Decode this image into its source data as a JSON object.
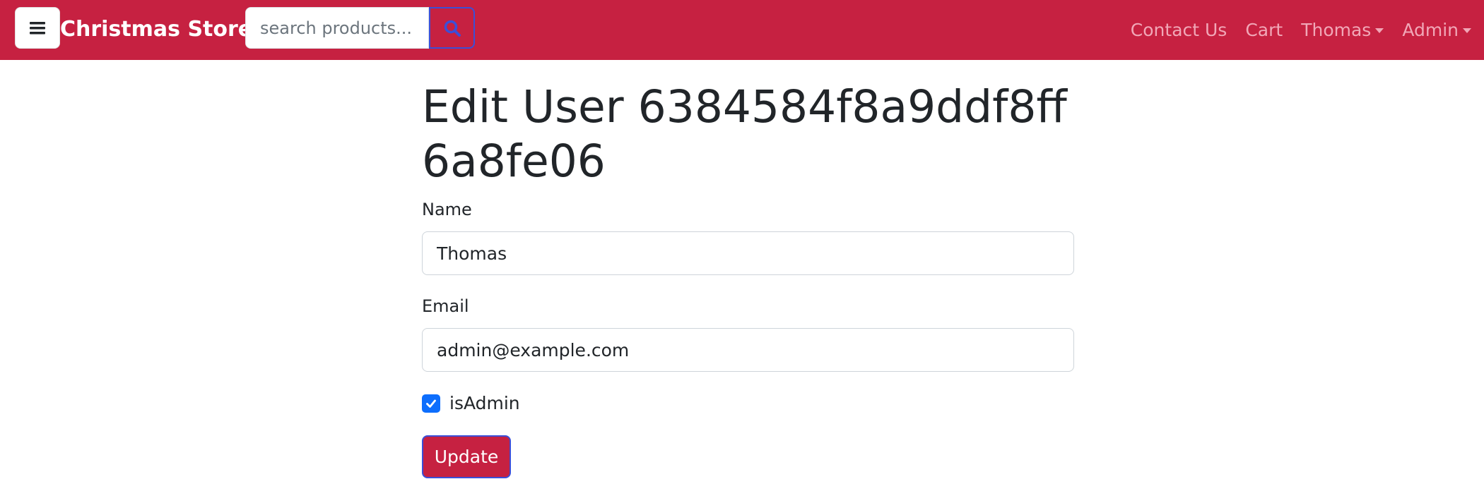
{
  "navbar": {
    "brand": "Christmas Store",
    "search_placeholder": "search products...",
    "menu_icon": "hamburger-icon",
    "search_icon": "search-icon",
    "links": {
      "contact": "Contact Us",
      "cart": "Cart",
      "user_menu": "Thomas",
      "admin_menu": "Admin"
    },
    "color": "#c62141"
  },
  "page": {
    "title": "Edit User 6384584f8a9ddf8ff6a8fe06"
  },
  "form": {
    "name_label": "Name",
    "name_value": "Thomas",
    "email_label": "Email",
    "email_value": "admin@example.com",
    "is_admin_label": "isAdmin",
    "is_admin_checked": true,
    "submit_label": "Update"
  }
}
